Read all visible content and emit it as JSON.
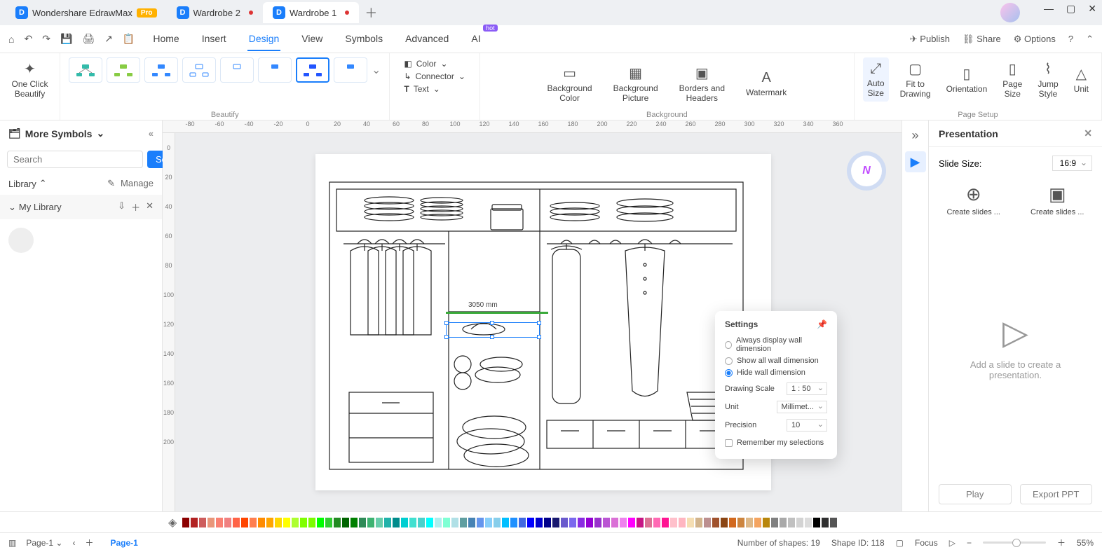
{
  "app_name": "Wondershare EdrawMax",
  "pro_badge": "Pro",
  "tabs": [
    {
      "label": "Wardrobe 2",
      "dirty": true
    },
    {
      "label": "Wardrobe 1",
      "dirty": true,
      "active": true
    }
  ],
  "menus": [
    "Home",
    "Insert",
    "Design",
    "View",
    "Symbols",
    "Advanced",
    "AI"
  ],
  "active_menu": "Design",
  "hot_badge": "hot",
  "top_right": {
    "publish": "Publish",
    "share": "Share",
    "options": "Options"
  },
  "ribbon": {
    "one_click": "One Click\nBeautify",
    "beautify_label": "Beautify",
    "color": "Color",
    "connector": "Connector",
    "text": "Text",
    "bg": {
      "color": "Background\nColor",
      "picture": "Background\nPicture",
      "borders": "Borders and\nHeaders",
      "watermark": "Watermark",
      "label": "Background"
    },
    "page": {
      "auto": "Auto\nSize",
      "fit": "Fit to\nDrawing",
      "orient": "Orientation",
      "size": "Page\nSize",
      "jump": "Jump\nStyle",
      "unit": "Unit",
      "label": "Page Setup"
    }
  },
  "sidebar": {
    "header": "More Symbols",
    "search_placeholder": "Search",
    "search_btn": "Search",
    "library": "Library",
    "manage": "Manage",
    "mylib": "My Library"
  },
  "ruler_h": [
    "-80",
    "-60",
    "-40",
    "-20",
    "0",
    "20",
    "40",
    "60",
    "80",
    "100",
    "120",
    "140",
    "160",
    "180",
    "200",
    "220",
    "240",
    "260",
    "280",
    "300",
    "320",
    "340",
    "360"
  ],
  "ruler_v": [
    "0",
    "20",
    "40",
    "60",
    "80",
    "100",
    "120",
    "140",
    "160",
    "180",
    "200"
  ],
  "canvas": {
    "dimension_label": "3050 mm"
  },
  "popup": {
    "title": "Settings",
    "opt1": "Always display wall dimension",
    "opt2": "Show all wall dimension",
    "opt3": "Hide wall dimension",
    "drawing_scale": "Drawing Scale",
    "drawing_scale_val": "1 : 50",
    "unit": "Unit",
    "unit_val": "Millimet...",
    "precision": "Precision",
    "precision_val": "10",
    "remember": "Remember my selections"
  },
  "right_panel": {
    "title": "Presentation",
    "slide_size": "Slide Size:",
    "slide_ratio": "16:9",
    "create1": "Create slides ...",
    "create2": "Create slides ...",
    "empty_text": "Add a slide to create a presentation.",
    "play": "Play",
    "export": "Export PPT"
  },
  "status": {
    "page_selector": "Page-1",
    "page_tab": "Page-1",
    "shapes": "Number of shapes: 19",
    "shape_id": "Shape ID: 118",
    "focus": "Focus",
    "zoom": "55%"
  },
  "colors": [
    "#8b0000",
    "#b22222",
    "#cd5c5c",
    "#e9967a",
    "#fa8072",
    "#f08080",
    "#ff6347",
    "#ff4500",
    "#ff7f50",
    "#ff8c00",
    "#ffa500",
    "#ffd700",
    "#ffff00",
    "#adff2f",
    "#7fff00",
    "#7cfc00",
    "#00ff00",
    "#32cd32",
    "#228b22",
    "#006400",
    "#008000",
    "#2e8b57",
    "#3cb371",
    "#66cdaa",
    "#20b2aa",
    "#008b8b",
    "#00ced1",
    "#40e0d0",
    "#48d1cc",
    "#00ffff",
    "#afeeee",
    "#7fffd4",
    "#b0e0e6",
    "#5f9ea0",
    "#4682b4",
    "#6495ed",
    "#87cefa",
    "#87ceeb",
    "#00bfff",
    "#1e90ff",
    "#4169e1",
    "#0000ff",
    "#0000cd",
    "#00008b",
    "#191970",
    "#6a5acd",
    "#7b68ee",
    "#8a2be2",
    "#9400d3",
    "#9932cc",
    "#ba55d3",
    "#da70d6",
    "#ee82ee",
    "#ff00ff",
    "#c71585",
    "#db7093",
    "#ff69b4",
    "#ff1493",
    "#ffc0cb",
    "#ffb6c1",
    "#f5deb3",
    "#d2b48c",
    "#bc8f8f",
    "#a0522d",
    "#8b4513",
    "#d2691e",
    "#cd853f",
    "#deb887",
    "#f4a460",
    "#b8860b",
    "#808080",
    "#a9a9a9",
    "#c0c0c0",
    "#d3d3d3",
    "#dcdcdc",
    "#000000",
    "#2f2f2f",
    "#555555"
  ]
}
